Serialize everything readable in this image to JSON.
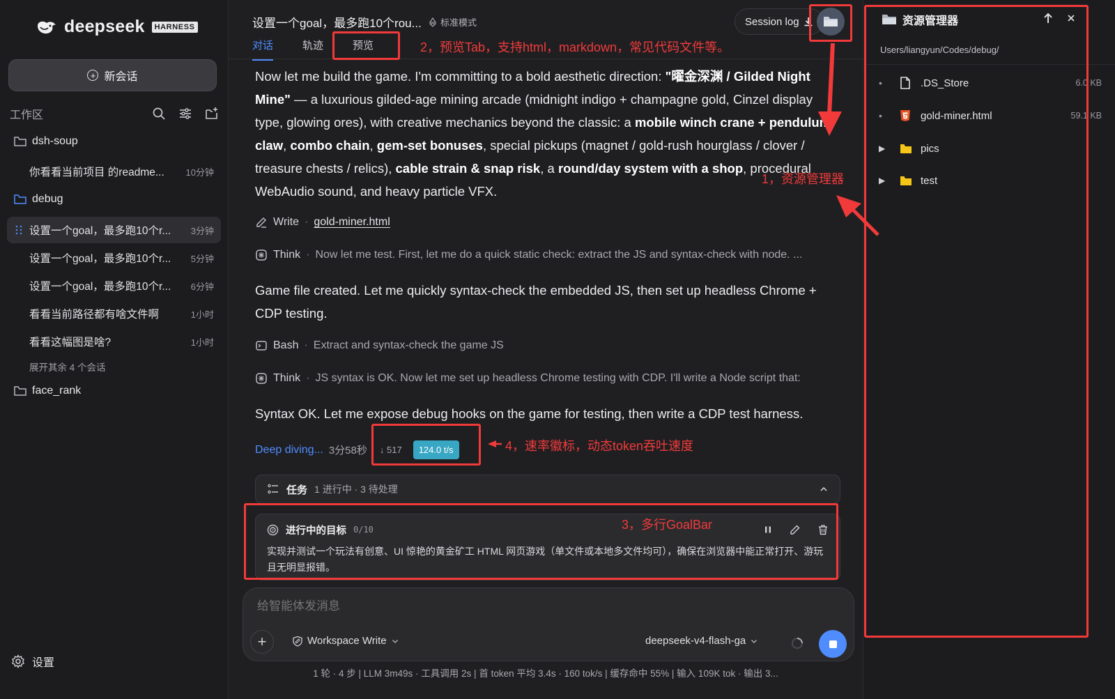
{
  "sidebar": {
    "logo_text": "deepseek",
    "logo_badge": "HARNESS",
    "new_chat_label": "新会话",
    "workspace_label": "工作区",
    "folders": [
      {
        "name": "dsh-soup"
      },
      {
        "name": "debug"
      },
      {
        "name": "face_rank"
      }
    ],
    "sessions": [
      {
        "title": "你看看当前项目 的readme...",
        "time": "10分钟"
      },
      {
        "title": "设置一个goal，最多跑10个r...",
        "time": "3分钟"
      },
      {
        "title": "设置一个goal，最多跑10个r...",
        "time": "5分钟"
      },
      {
        "title": "设置一个goal，最多跑10个r...",
        "time": "6分钟"
      },
      {
        "title": "看看当前路径都有啥文件啊",
        "time": "1小时"
      },
      {
        "title": "看看这幅图是啥?",
        "time": "1小时"
      }
    ],
    "expand_more": "展开其余 4 个会话",
    "settings_label": "设置"
  },
  "header": {
    "chat_title": "设置一个goal，最多跑10个rou...",
    "mode": "标准模式",
    "session_log": "Session log",
    "tabs": [
      {
        "label": "对话"
      },
      {
        "label": "轨迹"
      },
      {
        "label": "预览"
      }
    ]
  },
  "conversation": {
    "msg1_p1": "Now let me build the game. I'm committing to a bold aesthetic direction: ",
    "msg1_b1": "\"曜金深渊 / Gilded Night Mine\"",
    "msg1_p2": " — a luxurious gilded-age mining arcade (midnight indigo + champagne gold, Cinzel display type, glowing ores), with creative mechanics beyond the classic: a ",
    "msg1_b2": "mobile winch crane + pendulum claw",
    "msg1_p3": ", ",
    "msg1_b3": "combo chain",
    "msg1_p4": ", ",
    "msg1_b4": "gem-set bonuses",
    "msg1_p5": ", special pickups (magnet / gold-rush hourglass / clover / treasure chests / relics), ",
    "msg1_b5": "cable strain & snap risk",
    "msg1_p6": ", a ",
    "msg1_b6": "round/day system with a shop",
    "msg1_p7": ", procedural WebAudio sound, and heavy particle VFX.",
    "tool1_name": "Write",
    "tool1_link": "gold-miner.html",
    "tool2_name": "Think",
    "tool2_desc": "Now let me test. First, let me do a quick static check: extract the JS and syntax-check with node. ...",
    "msg2": "Game file created. Let me quickly syntax-check the embedded JS, then set up headless Chrome + CDP testing.",
    "tool3_name": "Bash",
    "tool3_desc": "Extract and syntax-check the game JS",
    "tool4_name": "Think",
    "tool4_desc": "JS syntax is OK. Now let me set up headless Chrome testing with CDP. I'll write a Node script that:",
    "msg3": "Syntax OK. Let me expose debug hooks on the game for testing, then write a CDP test harness.",
    "deep_label": "Deep diving...",
    "deep_time": "3分58秒",
    "token_count": "↓ 517",
    "rate": "124.0 t/s",
    "separator": "·"
  },
  "task_bar": {
    "title": "任务",
    "meta": "1 进行中 · 3 待处理"
  },
  "goal_bar": {
    "title": "进行中的目标",
    "count": "0/10",
    "text": "实现并测试一个玩法有创意、UI 惊艳的黄金矿工 HTML 网页游戏（单文件或本地多文件均可），确保在浏览器中能正常打开、游玩且无明显报错。"
  },
  "composer": {
    "placeholder": "给智能体发消息",
    "permission": "Workspace Write",
    "model": "deepseek-v4-flash-ga"
  },
  "status_line": "1 轮 · 4 步   |   LLM 3m49s · 工具调用 2s   |   首 token 平均 3.4s · 160 tok/s   |   缓存命中 55%   |   输入 109K tok · 输出 3...",
  "explorer": {
    "title": "资源管理器",
    "path": "Users/liangyun/Codes/debug/",
    "items": [
      {
        "name": ".DS_Store",
        "size": "6.0 KB",
        "kind": "file",
        "icon": "file-icon"
      },
      {
        "name": "gold-miner.html",
        "size": "59.1 KB",
        "kind": "html",
        "icon": "html5-icon"
      },
      {
        "name": "pics",
        "size": "",
        "kind": "folder",
        "icon": "folder-icon"
      },
      {
        "name": "test",
        "size": "",
        "kind": "folder",
        "icon": "folder-icon"
      }
    ]
  },
  "annotations": {
    "a1": "1，资源管理器",
    "a2": "2，预览Tab，支持html，markdown，常见代码文件等。",
    "a3": "3，多行GoalBar",
    "a4": "4，速率徽标，动态token吞吐速度",
    "color": "#f23a3a"
  },
  "colors": {
    "accent": "#4f8dff",
    "rate_badge": "#38a7c4",
    "background": "#1f1f22"
  }
}
